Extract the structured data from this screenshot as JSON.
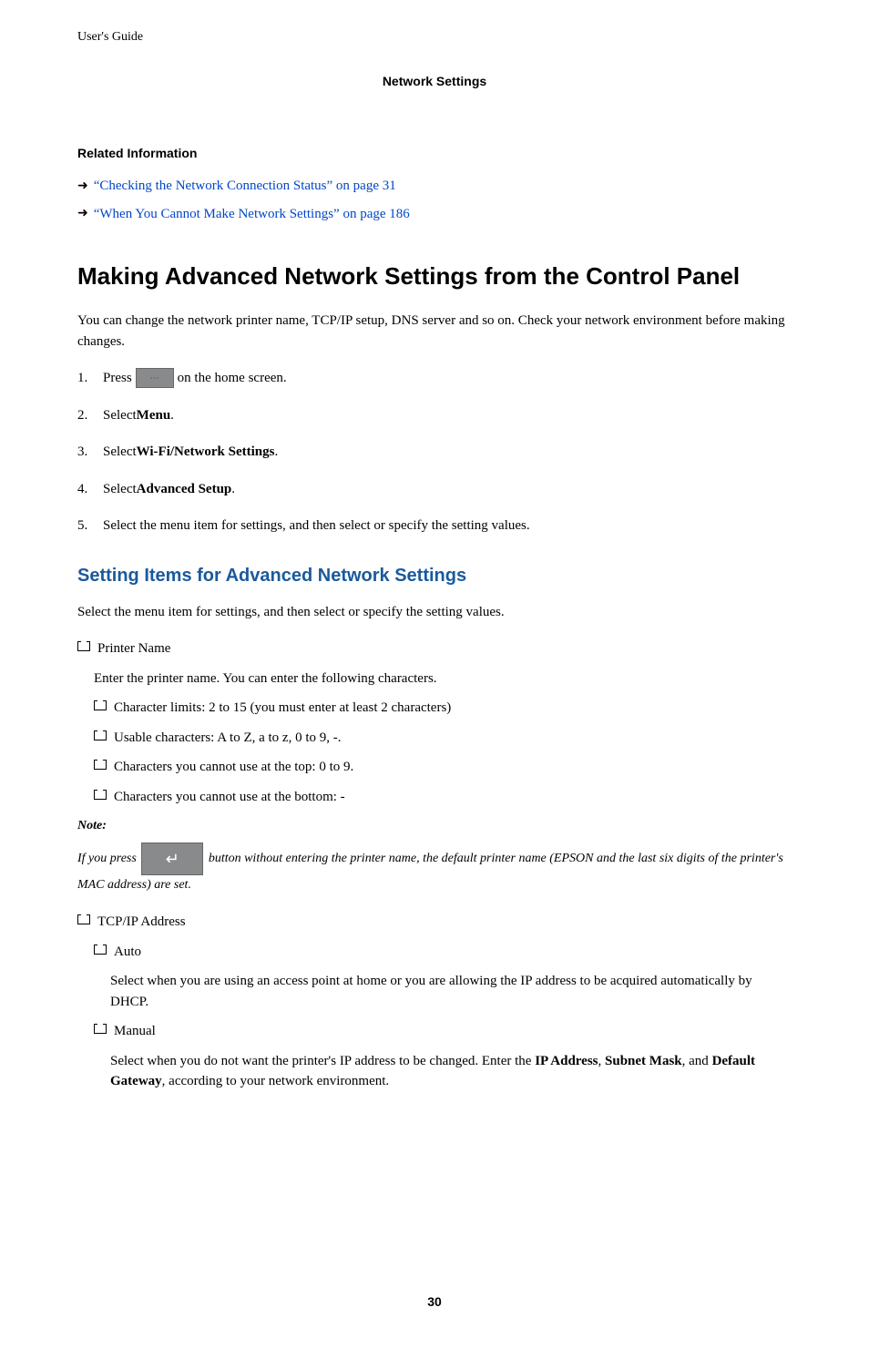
{
  "header": {
    "left": "User's Guide",
    "center": "Network Settings"
  },
  "related_info": {
    "heading": "Related Information",
    "links": [
      "“Checking the Network Connection Status” on page 31",
      "“When You Cannot Make Network Settings” on page 186"
    ]
  },
  "main": {
    "heading": "Making Advanced Network Settings from the Control Panel",
    "intro": "You can change the network printer name, TCP/IP setup, DNS server and so on. Check your network environment before making changes.",
    "steps": {
      "s1_a": "Press ",
      "s1_b": " on the home screen.",
      "s2_a": "Select ",
      "s2_b": "Menu",
      "s2_c": ".",
      "s3_a": "Select ",
      "s3_b": "Wi-Fi/Network Settings",
      "s3_c": ".",
      "s4_a": "Select ",
      "s4_b": "Advanced Setup",
      "s4_c": ".",
      "s5": "Select the menu item for settings, and then select or specify the setting values."
    }
  },
  "sub": {
    "heading": "Setting Items for Advanced Network Settings",
    "intro": "Select the menu item for settings, and then select or specify the setting values.",
    "printer_name": {
      "title": "Printer Name",
      "desc": "Enter the printer name. You can enter the following characters.",
      "items": [
        "Character limits: 2 to 15 (you must enter at least 2 characters)",
        "Usable characters: A to Z, a to z, 0 to 9, -.",
        "Characters you cannot use at the top: 0 to 9.",
        "Characters you cannot use at the bottom: -"
      ]
    },
    "note": {
      "label": "Note:",
      "text_a": "If you press ",
      "text_b": " button without entering the printer name, the default printer name (EPSON and the last six digits of the printer's MAC address) are set."
    },
    "tcpip": {
      "title": "TCP/IP Address",
      "auto": {
        "title": "Auto",
        "desc": "Select when you are using an access point at home or you are allowing the IP address to be acquired automatically by DHCP."
      },
      "manual": {
        "title": "Manual",
        "desc_a": "Select when you do not want the printer's IP address to be changed. Enter the ",
        "desc_b": "IP Address",
        "desc_c": ", ",
        "desc_d": "Subnet Mask",
        "desc_e": ", and ",
        "desc_f": "Default Gateway",
        "desc_g": ", according to your network environment."
      }
    }
  },
  "page_number": "30"
}
